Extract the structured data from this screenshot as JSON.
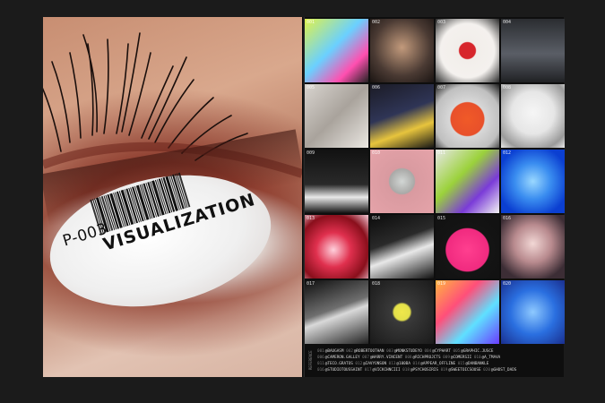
{
  "left_page": {
    "barcode_code": "P-003",
    "barcode_word": "VISUALIZATION"
  },
  "grid": {
    "tiles": [
      {
        "num": "001",
        "bg": "linear-gradient(135deg,#e0f24a,#6ad0ff 45%,#ff4fb0 75%,#222)"
      },
      {
        "num": "002",
        "bg": "radial-gradient(circle at 50% 45%,#c29a7c,#4a3a33 60%,#1a1412)"
      },
      {
        "num": "003",
        "bg": "radial-gradient(circle at 50% 50%,#d7262c 0%,#d7262c 18%,#f2eeea 20%,#f4f1ee 60%,#2a2a2a 100%)"
      },
      {
        "num": "004",
        "bg": "linear-gradient(180deg,#2b2d31,#5a5e66 55%,#202124)"
      },
      {
        "num": "005",
        "bg": "linear-gradient(135deg,#d8d4cf,#a9a39c 50%,#eae7e2)"
      },
      {
        "num": "006",
        "bg": "linear-gradient(160deg,#1b1b25,#2f3556 45%,#e7c43d 70%,#161616)"
      },
      {
        "num": "007",
        "bg": "radial-gradient(circle at 50% 55%,#f05a28 0%,#e8502a 35%,#d8d8d8 37%,#bfbfbf 70%,#1a1a1a)"
      },
      {
        "num": "008",
        "bg": "radial-gradient(circle at 50% 45%,#f6f6f6,#e6e6e6 45%,#9a9a9a 80%,#e9e9e9)"
      },
      {
        "num": "009",
        "bg": "linear-gradient(180deg,#111,#2a2a2a 55%,#e9e9e9 75%,#111)"
      },
      {
        "num": "010",
        "bg": "radial-gradient(circle at 50% 50%,#d2d6d4 0%,#a9a9a7 28%,#d99aa0 30%,#e5a3a9 100%)"
      },
      {
        "num": "011",
        "bg": "linear-gradient(135deg,#e7e7e7,#9bd23b 40%,#7a3bd8 70%,#f2f2f2)"
      },
      {
        "num": "012",
        "bg": "radial-gradient(circle at 50% 50%,#9ad8ff,#3a8df0 40%,#0b3fd1 80%)"
      },
      {
        "num": "013",
        "bg": "radial-gradient(circle at 45% 55%,#ffd0dc,#e0304e 35%,#8a0f1c 70%,#f3c9d6)"
      },
      {
        "num": "014",
        "bg": "linear-gradient(160deg,#0c0c0c,#2a2a2a 40%,#e8e8e8 60%,#101010)"
      },
      {
        "num": "015",
        "bg": "radial-gradient(circle at 50% 55%,#ff3f8f 0%,#f02a7f 45%,#141414 47%,#111 100%)"
      },
      {
        "num": "016",
        "bg": "radial-gradient(circle at 50% 45%,#f2d7d5,#b88a8e 40%,#3c2d35 80%)"
      },
      {
        "num": "017",
        "bg": "linear-gradient(160deg,#0f0f0f,#6f6f6f 45%,#d9d9d9 55%,#222)"
      },
      {
        "num": "018",
        "bg": "radial-gradient(circle at 50% 50%,#f0e84a 0%,#e3e04a 18%,#3a3a3a 22%,#1a1a1a 100%)"
      },
      {
        "num": "019",
        "bg": "linear-gradient(135deg,#ffb340,#ff4f7a 35%,#5fe0ff 65%,#6a3bff)"
      },
      {
        "num": "020",
        "bg": "radial-gradient(circle at 50% 50%,#8ec9ff,#2a6fe0 50%,#1a2f8f)"
      }
    ]
  },
  "credits": {
    "reference_label": "REFERENCE",
    "rows": [
      [
        {
          "n": "001",
          "h": "@BAUGASM"
        },
        {
          "n": "002",
          "h": "@ROBERTOOTHAN"
        },
        {
          "n": "003",
          "h": "@MONKSTUDEYO"
        },
        {
          "n": "004",
          "h": "@CYPHART"
        },
        {
          "n": "005",
          "h": "@GRAPHIC.JUSCE"
        }
      ],
      [
        {
          "n": "006",
          "h": "@CAMERON.GALLEY"
        },
        {
          "n": "007",
          "h": "@HARRY.VINCENT"
        },
        {
          "n": "008",
          "h": "@RICHPROJCTS"
        },
        {
          "n": "009",
          "h": "@COMERSII"
        },
        {
          "n": "010",
          "h": "@A_TMAVA"
        }
      ],
      [
        {
          "n": "011",
          "h": "@TECO.GRATOS"
        },
        {
          "n": "012",
          "h": "@IAVYONSON"
        },
        {
          "n": "013",
          "h": "@100BA"
        },
        {
          "n": "014",
          "h": "@APPEAR_OFFLINE"
        },
        {
          "n": "015",
          "h": "@DANBANKLE"
        }
      ],
      [
        {
          "n": "016",
          "h": "@STUDIOTOUSSAINT"
        },
        {
          "n": "017",
          "h": "@VICKCHNCIII"
        },
        {
          "n": "018",
          "h": "@PSYCHOSIRIS"
        },
        {
          "n": "019",
          "h": "@SWEETOICSOUSE"
        },
        {
          "n": "020",
          "h": "@GHOST_DADS"
        }
      ]
    ]
  }
}
